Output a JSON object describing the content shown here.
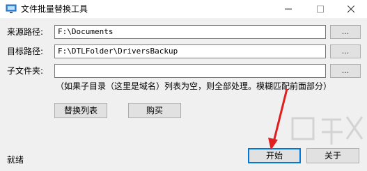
{
  "window": {
    "title": "文件批量替换工具"
  },
  "form": {
    "source_label": "来源路径:",
    "source_value": "F:\\Documents",
    "target_label": "目标路径:",
    "target_value": "F:\\DTLFolder\\DriversBackup",
    "subfolder_label": "子文件夹:",
    "subfolder_value": "",
    "browse_label": "...",
    "note": "（如果子目录（这里是域名）列表为空，则全部处理。模糊匹配前面部分）"
  },
  "buttons": {
    "replace_list": "替换列表",
    "buy": "购买",
    "start": "开始",
    "about": "关于"
  },
  "status": {
    "text": "就绪"
  },
  "colors": {
    "annotation_arrow": "#e02020",
    "focus_border": "#0078d7"
  }
}
